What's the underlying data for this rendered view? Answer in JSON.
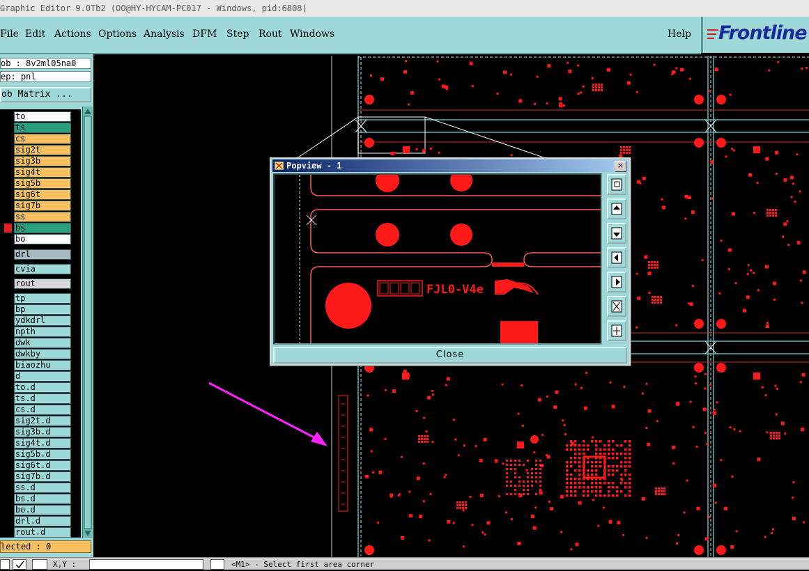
{
  "window": {
    "title": "Graphic Editor 9.0Tb2 (OO@HY-HYCAM-PC017 - Windows, pid:6808)"
  },
  "menu": {
    "items": [
      "File",
      "Edit",
      "Actions",
      "Options",
      "Analysis",
      "DFM",
      "Step",
      "Rout",
      "Windows"
    ],
    "help": "Help"
  },
  "logo": {
    "text": "Frontline"
  },
  "sidebar": {
    "job": "ob : 8v2ml05na0",
    "step": "ep: pnl",
    "matrix_button": "ob Matrix ...",
    "layers": [
      {
        "name": "to",
        "color": "#ffffff"
      },
      {
        "name": "ts",
        "color": "#2aa080"
      },
      {
        "name": "cs",
        "color": "#f8c060"
      },
      {
        "name": "sig2t",
        "color": "#f8c060"
      },
      {
        "name": "sig3b",
        "color": "#f8c060"
      },
      {
        "name": "sig4t",
        "color": "#f8c060"
      },
      {
        "name": "sig5b",
        "color": "#f8c060"
      },
      {
        "name": "sig6t",
        "color": "#f8c060"
      },
      {
        "name": "sig7b",
        "color": "#f8c060"
      },
      {
        "name": "ss",
        "color": "#f8c060"
      },
      {
        "name": "bs",
        "color": "#2aa080"
      },
      {
        "name": "bo",
        "color": "#ffffff"
      },
      {
        "name": "drl",
        "color": "#a8b8c0"
      },
      {
        "name": "cvia",
        "color": "#9fd8d8"
      },
      {
        "name": "rout",
        "color": "#d8d8d8"
      },
      {
        "name": "tp",
        "color": "#9fd8d8"
      },
      {
        "name": "bp",
        "color": "#9fd8d8"
      },
      {
        "name": "ydkdrl",
        "color": "#9fd8d8"
      },
      {
        "name": "npth",
        "color": "#9fd8d8"
      },
      {
        "name": "dwk",
        "color": "#9fd8d8"
      },
      {
        "name": "dwkby",
        "color": "#9fd8d8"
      },
      {
        "name": "biaozhu",
        "color": "#9fd8d8"
      },
      {
        "name": "d",
        "color": "#9fd8d8"
      },
      {
        "name": "to.d",
        "color": "#9fd8d8"
      },
      {
        "name": "ts.d",
        "color": "#9fd8d8"
      },
      {
        "name": "cs.d",
        "color": "#9fd8d8"
      },
      {
        "name": "sig2t.d",
        "color": "#9fd8d8"
      },
      {
        "name": "sig3b.d",
        "color": "#9fd8d8"
      },
      {
        "name": "sig4t.d",
        "color": "#9fd8d8"
      },
      {
        "name": "sig5b.d",
        "color": "#9fd8d8"
      },
      {
        "name": "sig6t.d",
        "color": "#9fd8d8"
      },
      {
        "name": "sig7b.d",
        "color": "#9fd8d8"
      },
      {
        "name": "ss.d",
        "color": "#9fd8d8"
      },
      {
        "name": "bs.d",
        "color": "#9fd8d8"
      },
      {
        "name": "bo.d",
        "color": "#9fd8d8"
      },
      {
        "name": "drl.d",
        "color": "#9fd8d8"
      },
      {
        "name": "rout.d",
        "color": "#9fd8d8"
      }
    ],
    "selected": "lected : 0"
  },
  "popup": {
    "title": "Popview - 1",
    "close_label": "Close",
    "board_text": "FJL0-V4e"
  },
  "statusbar": {
    "coord_label": "X,Y :",
    "message": "<M1> - Select first area corner"
  },
  "colors": {
    "panel": "#9fd8d8",
    "copper": "#ff0000",
    "profile": "#5ab8b8"
  }
}
